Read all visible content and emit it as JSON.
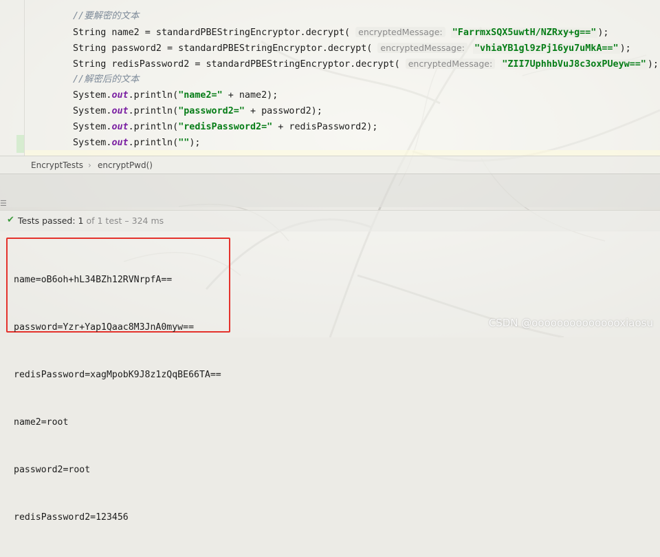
{
  "editor": {
    "lines": [
      [
        {
          "cls": "cm",
          "t": "//要解密的文本"
        }
      ],
      [
        {
          "t": "String name2 = standardPBEStringEncryptor.decrypt( "
        },
        {
          "cls": "hint",
          "t": "encryptedMessage:"
        },
        {
          "t": " "
        },
        {
          "cls": "hint-val",
          "t": "\"FarrmxSQX5uwtH/NZRxy+g==\""
        },
        {
          "t": ");"
        }
      ],
      [
        {
          "t": "String password2 = standardPBEStringEncryptor.decrypt( "
        },
        {
          "cls": "hint",
          "t": "encryptedMessage:"
        },
        {
          "t": " "
        },
        {
          "cls": "hint-val",
          "t": "\"vhiaYB1gl9zPj16yu7uMkA==\""
        },
        {
          "t": ");"
        }
      ],
      [
        {
          "t": "String redisPassword2 = standardPBEStringEncryptor.decrypt( "
        },
        {
          "cls": "hint",
          "t": "encryptedMessage:"
        },
        {
          "t": " "
        },
        {
          "cls": "hint-val",
          "t": "\"ZII7UphhbVuJ8c3oxPUeyw==\""
        },
        {
          "t": ");"
        }
      ],
      [
        {
          "cls": "cm",
          "t": "//解密后的文本"
        }
      ],
      [
        {
          "t": "System."
        },
        {
          "cls": "kw",
          "t": "out"
        },
        {
          "t": ".println("
        },
        {
          "cls": "str",
          "t": "\"name2=\""
        },
        {
          "t": " + name2);"
        }
      ],
      [
        {
          "t": "System."
        },
        {
          "cls": "kw",
          "t": "out"
        },
        {
          "t": ".println("
        },
        {
          "cls": "str",
          "t": "\"password2=\""
        },
        {
          "t": " + password2);"
        }
      ],
      [
        {
          "t": "System."
        },
        {
          "cls": "kw",
          "t": "out"
        },
        {
          "t": ".println("
        },
        {
          "cls": "str",
          "t": "\"redisPassword2=\""
        },
        {
          "t": " + redisPassword2);"
        }
      ],
      [
        {
          "t": "System."
        },
        {
          "cls": "kw",
          "t": "out"
        },
        {
          "t": ".println("
        },
        {
          "cls": "str",
          "t": "\"\""
        },
        {
          "t": ");"
        }
      ]
    ]
  },
  "breadcrumb": {
    "class_name": "EncryptTests",
    "separator": "›",
    "method_name": "encryptPwd()"
  },
  "strip": {
    "glyph": "☰"
  },
  "test_status": {
    "check_icon": "✔",
    "label": "Tests passed:",
    "passed": "1",
    "of_text": "of 1 test",
    "duration": "– 324 ms"
  },
  "console": {
    "lines": [
      "name=oB6oh+hL34BZh12RVNrpfA==",
      "password=Yzr+Yap1Qaac8M3JnA0myw==",
      "redisPassword=xagMpobK9J8z1zQqBE66TA==",
      "name2=root",
      "password2=root",
      "redisPassword2=123456"
    ]
  },
  "watermark": "CSDN @ooooooooooooooxiaosu",
  "colors": {
    "comment": "#7d8a99",
    "keyword": "#7a1fa2",
    "string": "#067d17",
    "highlight_border": "#e4312b",
    "pass_green": "#3b9a3b"
  }
}
